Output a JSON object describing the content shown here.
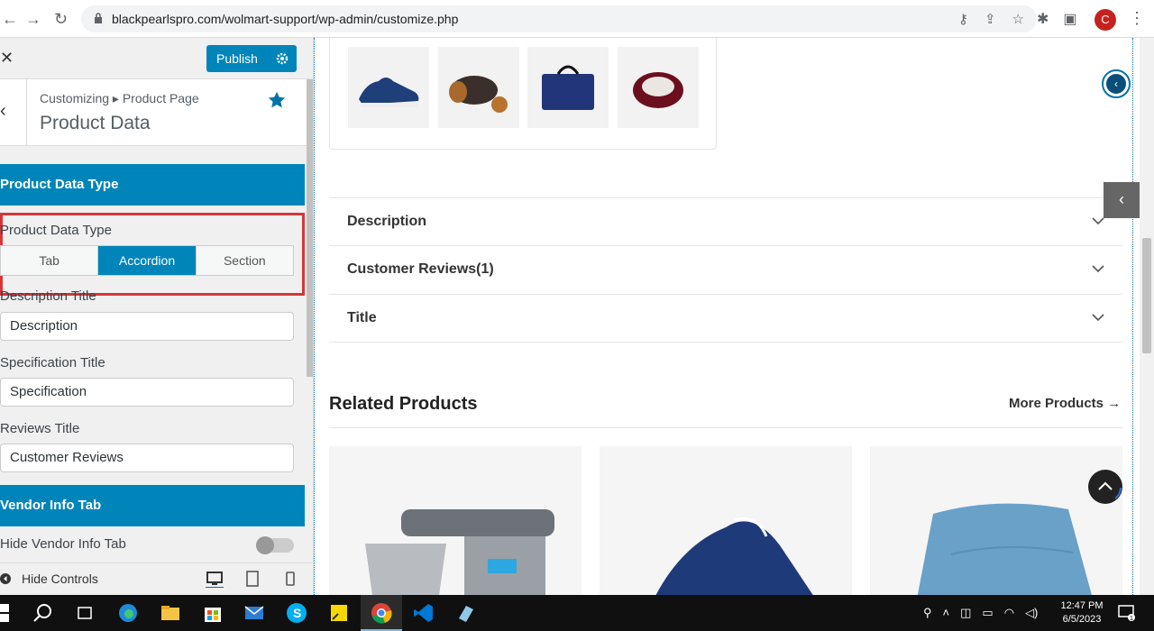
{
  "browser": {
    "url": "blackpearlspro.com/wolmart-support/wp-admin/customize.php",
    "avatar_letter": "C"
  },
  "customizer": {
    "close_icon": "close-icon",
    "publish_label": "Publish",
    "breadcrumb": "Customizing ▸ Product Page",
    "panel_title": "Product Data",
    "section_product_data_type": "Product Data Type",
    "control_product_data_type_label": "Product Data Type",
    "segments": [
      "Tab",
      "Accordion",
      "Section"
    ],
    "active_segment": "Accordion",
    "description_title_label": "Description Title",
    "description_title_value": "Description",
    "specification_title_label": "Specification Title",
    "specification_title_value": "Specification",
    "reviews_title_label": "Reviews Title",
    "reviews_title_value": "Customer Reviews",
    "section_vendor_info": "Vendor Info Tab",
    "hide_vendor_label": "Hide Vendor Info Tab",
    "hide_vendor_on": false,
    "hide_controls_label": "Hide Controls"
  },
  "preview": {
    "accordion": [
      {
        "title": "Description"
      },
      {
        "title": "Customer Reviews(1)"
      },
      {
        "title": "Title"
      }
    ],
    "related_title": "Related Products",
    "more_products_label": "More Products",
    "gallery_thumbs": [
      "sneaker",
      "duffel-bag",
      "laptop-bag",
      "pet-bed"
    ],
    "related_products": [
      "stand-mixer",
      "blue-sneaker",
      "blue-towel"
    ]
  },
  "taskbar": {
    "time": "12:47 PM",
    "date": "6/5/2023",
    "notification_count": "1"
  },
  "colors": {
    "accent": "#0085ba",
    "highlight_border": "#d63638"
  }
}
